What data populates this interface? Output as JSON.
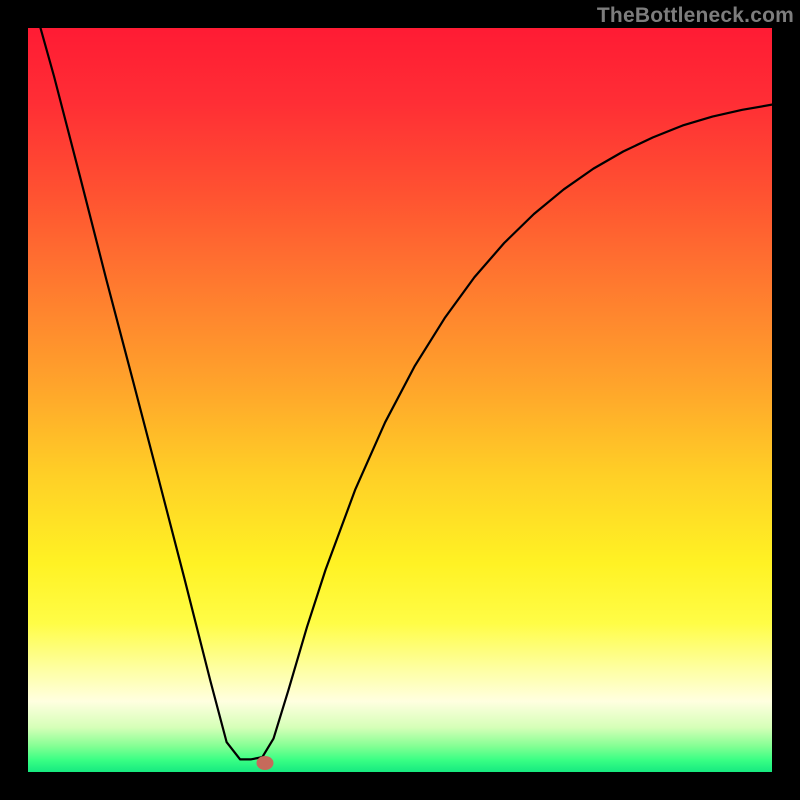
{
  "watermark": {
    "text": "TheBottleneck.com"
  },
  "chart_data": {
    "type": "line",
    "title": "",
    "xlabel": "",
    "ylabel": "",
    "xlim": [
      0,
      1
    ],
    "ylim": [
      0,
      1
    ],
    "x": [
      0.0,
      0.035,
      0.07,
      0.105,
      0.14,
      0.175,
      0.21,
      0.245,
      0.267,
      0.285,
      0.3,
      0.315,
      0.33,
      0.35,
      0.375,
      0.4,
      0.44,
      0.48,
      0.52,
      0.56,
      0.6,
      0.64,
      0.68,
      0.72,
      0.76,
      0.8,
      0.84,
      0.88,
      0.92,
      0.96,
      1.0
    ],
    "values": [
      1.06,
      0.935,
      0.8,
      0.663,
      0.53,
      0.396,
      0.261,
      0.123,
      0.04,
      0.017,
      0.017,
      0.02,
      0.045,
      0.11,
      0.195,
      0.272,
      0.38,
      0.47,
      0.546,
      0.61,
      0.665,
      0.711,
      0.75,
      0.783,
      0.811,
      0.834,
      0.853,
      0.869,
      0.881,
      0.89,
      0.897
    ],
    "gradient_stops": [
      {
        "offset": 0.0,
        "color": "#ff1b34"
      },
      {
        "offset": 0.1,
        "color": "#ff2e35"
      },
      {
        "offset": 0.22,
        "color": "#ff5131"
      },
      {
        "offset": 0.35,
        "color": "#ff7b2f"
      },
      {
        "offset": 0.48,
        "color": "#ffa42b"
      },
      {
        "offset": 0.6,
        "color": "#ffcf26"
      },
      {
        "offset": 0.72,
        "color": "#fff224"
      },
      {
        "offset": 0.8,
        "color": "#fffd46"
      },
      {
        "offset": 0.86,
        "color": "#feffa0"
      },
      {
        "offset": 0.905,
        "color": "#ffffe0"
      },
      {
        "offset": 0.94,
        "color": "#d6ffb8"
      },
      {
        "offset": 0.965,
        "color": "#85ff94"
      },
      {
        "offset": 0.984,
        "color": "#39ff84"
      },
      {
        "offset": 1.0,
        "color": "#16e980"
      }
    ],
    "marker": {
      "x": 0.318,
      "y": 0.012,
      "color": "#c66a5b"
    }
  }
}
